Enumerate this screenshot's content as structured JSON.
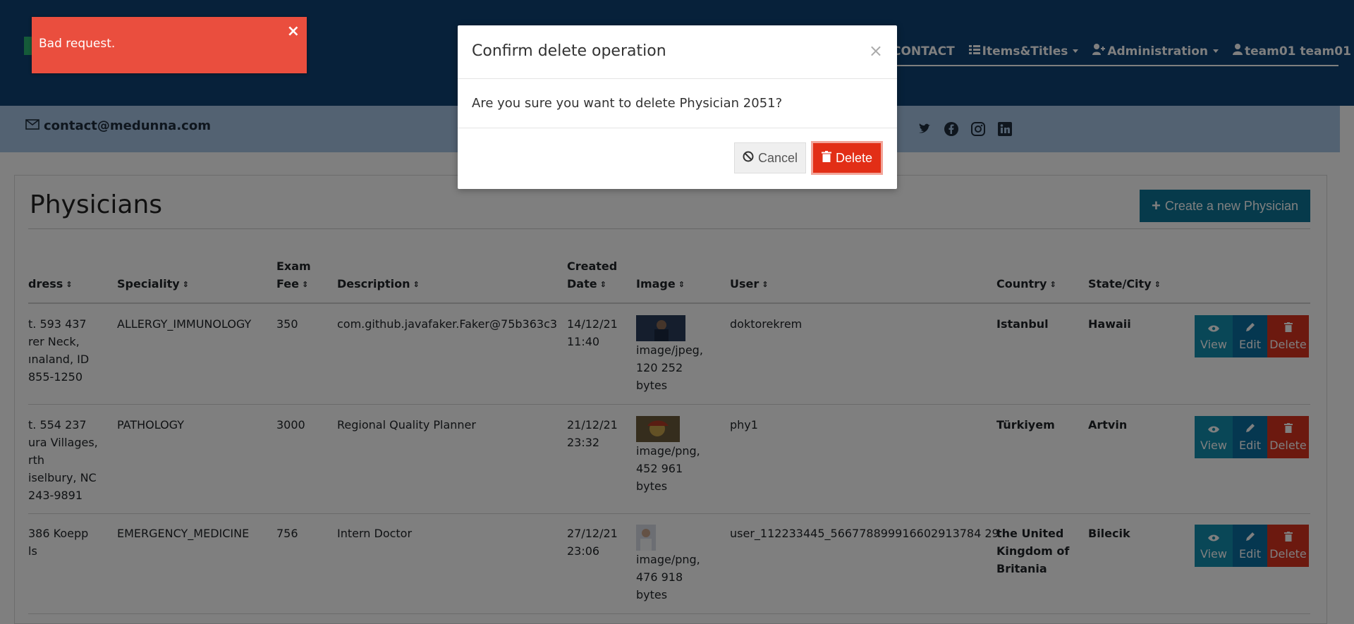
{
  "toast": {
    "message": "Bad request.",
    "close_glyph": "×"
  },
  "nav": {
    "items": [
      {
        "label": "CONTACT",
        "icon": ""
      },
      {
        "label": "Items&Titles",
        "icon": "list-icon"
      },
      {
        "label": "Administration",
        "icon": "user-plus-icon"
      },
      {
        "label": "team01 team01",
        "icon": "user-icon"
      }
    ]
  },
  "contact": {
    "email": "contact@medunna.com"
  },
  "page": {
    "title": "Physicians",
    "create_button": "Create a new Physician",
    "create_glyph": "+"
  },
  "table": {
    "headers": {
      "address": "dress",
      "speciality": "Speciality",
      "exam_fee_1": "Exam",
      "exam_fee_2": "Fee",
      "description": "Description",
      "created_1": "Created",
      "created_2": "Date",
      "image": "Image",
      "user": "User",
      "country": "Country",
      "state_city": "State/City"
    },
    "sort_glyph": "⇕",
    "rows": [
      {
        "address": [
          "t. 593 437",
          "rer Neck,",
          "ınaland, ID",
          "855-1250"
        ],
        "speciality": "ALLERGY_IMMUNOLOGY",
        "exam_fee": "350",
        "description": "com.github.javafaker.Faker@75b363c3",
        "created": [
          "14/12/21",
          "11:40"
        ],
        "image_info": [
          "image/jpeg,",
          "120 252",
          "bytes"
        ],
        "user": "doktorekrem",
        "country": "Istanbul",
        "state_city": "Hawaii"
      },
      {
        "address": [
          "t. 554 237",
          "ura Villages,",
          "rth",
          "iselbury, NC",
          "243-9891"
        ],
        "speciality": "PATHOLOGY",
        "exam_fee": "3000",
        "description": "Regional Quality Planner",
        "created": [
          "21/12/21",
          "23:32"
        ],
        "image_info": [
          "image/png,",
          "452 961",
          "bytes"
        ],
        "user": "phy1",
        "country": "Türkiyem",
        "state_city": "Artvin"
      },
      {
        "address": [
          "386 Koepp",
          "ls"
        ],
        "speciality": "EMERGENCY_MEDICINE",
        "exam_fee": "756",
        "description": "Intern Doctor",
        "created": [
          "27/12/21",
          "23:06"
        ],
        "image_info": [
          "image/png,",
          "476 918",
          "bytes"
        ],
        "user": "user_112233445_566778899916602913784 29",
        "country": [
          "the United",
          "Kingdom of",
          "Britania"
        ],
        "state_city": "Bilecik"
      }
    ],
    "actions": {
      "view": "View",
      "edit": "Edit",
      "delete": "Delete"
    }
  },
  "modal": {
    "title": "Confirm delete operation",
    "close_glyph": "×",
    "message": "Are you sure you want to delete Physician 2051?",
    "cancel": "Cancel",
    "delete": "Delete"
  },
  "colors": {
    "navbar": "#0f4275",
    "contact_bar": "#a6c5e4",
    "create_button": "#0c7596",
    "view": "#138fae",
    "edit": "#0a6ea0",
    "delete": "#d9321f",
    "toast": "#ea4e3e"
  }
}
